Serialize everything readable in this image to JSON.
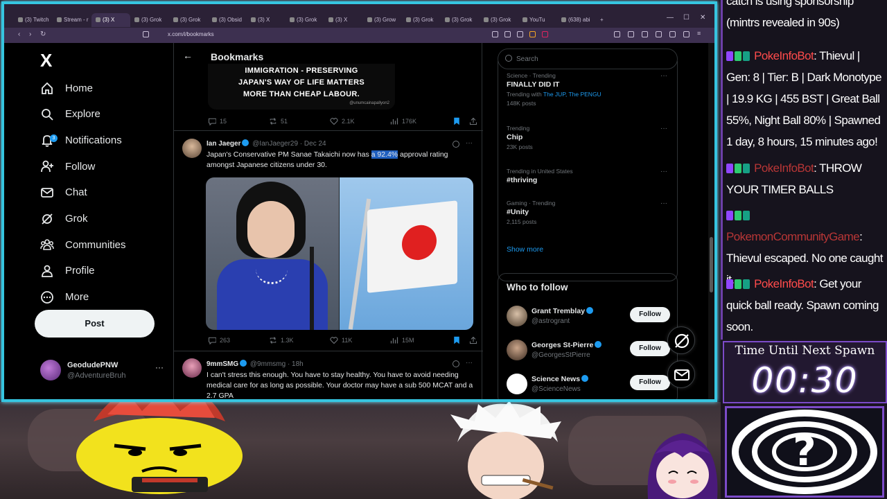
{
  "browser": {
    "tabs": [
      "(3) Twitch",
      "Stream - r",
      "(3) X",
      "(3) Grok",
      "(3) Grok",
      "(3) Obsid",
      "(3) X",
      "(3) Grok",
      "(3) X",
      "(3) Grow",
      "(3) Grok",
      "(3) Grok",
      "(3) Grok",
      "YouTu",
      "(638) abi"
    ],
    "active_tab_index": 2,
    "url": "x.com/i/bookmarks"
  },
  "sidebar": {
    "logo": "X",
    "items": [
      {
        "label": "Home",
        "icon": "home-icon"
      },
      {
        "label": "Explore",
        "icon": "search-icon"
      },
      {
        "label": "Notifications",
        "icon": "bell-icon",
        "badge": "3"
      },
      {
        "label": "Follow",
        "icon": "person-add-icon"
      },
      {
        "label": "Chat",
        "icon": "mail-icon"
      },
      {
        "label": "Grok",
        "icon": "grok-icon"
      },
      {
        "label": "Communities",
        "icon": "communities-icon"
      },
      {
        "label": "Profile",
        "icon": "person-icon"
      },
      {
        "label": "More",
        "icon": "more-circle-icon"
      }
    ],
    "post_label": "Post",
    "account": {
      "name": "GeodudePNW",
      "handle": "@AdventureBruh",
      "more": "···"
    }
  },
  "main": {
    "title": "Bookmarks",
    "prev_tweet": {
      "image_caption_1": "IMMIGRATION - PRESERVING",
      "image_caption_2": "JAPAN'S WAY OF LIFE MATTERS",
      "image_caption_3": "MORE THAN CHEAP LABOUR.",
      "watermark": "@unumcainapallyon2",
      "replies": "15",
      "reposts": "51",
      "likes": "2.1K",
      "views": "176K"
    },
    "tweets": [
      {
        "name": "Ian Jaeger",
        "handle": "@IanJaeger29",
        "date": "· Dec 24",
        "text_before": "Japan's Conservative PM Sanae Takaichi now has ",
        "highlight": "a 92.4%",
        "text_after": " approval rating amongst Japanese citizens under 30.",
        "replies": "263",
        "reposts": "1.3K",
        "likes": "11K",
        "views": "15M"
      },
      {
        "name": "9mmSMG",
        "handle": "@9mmsmg",
        "date": "· 18h",
        "text": "I can't stress this enough. You have to stay healthy. You have to avoid needing medical care for as long as possible. Your doctor may have a sub 500 MCAT and a 2.7 GPA"
      }
    ]
  },
  "right": {
    "search_placeholder": "Search",
    "trends": [
      {
        "category": "Science · Trending",
        "title": "FINALLY DID IT",
        "meta_prefix": "Trending with ",
        "meta_link": "The JUP, The PENGU",
        "meta2": "148K posts"
      },
      {
        "category": "Trending",
        "title": "Chip",
        "meta": "23K posts"
      },
      {
        "category": "Trending in United States",
        "title": "#thriving",
        "meta": ""
      },
      {
        "category": "Gaming · Trending",
        "title": "#Unity",
        "meta": "2,115 posts"
      }
    ],
    "show_more": "Show more",
    "who_to_follow_title": "Who to follow",
    "follow_label": "Follow",
    "who_to_follow": [
      {
        "name": "Grant Tremblay",
        "handle": "@astrogrant"
      },
      {
        "name": "Georges St-Pierre",
        "handle": "@GeorgesStPierre"
      },
      {
        "name": "Science News",
        "handle": "@ScienceNews"
      }
    ]
  },
  "chat": {
    "lines": [
      {
        "user": "",
        "text": "catch is using sponsorship (mintrs revealed in 90s)"
      },
      {
        "user": "PokeInfoBot",
        "text": ": Thievul | Gen: 8 | Tier: B | Dark Monotype | 19.9 KG | 455 BST | Great Ball 55%, Night Ball 80% | Spawned 1 day, 8 hours, 15 minutes ago!"
      },
      {
        "user": "PokeInfoBot",
        "text": ": THROW YOUR TIMER BALLS"
      },
      {
        "user": "PokemonCommunityGame",
        "text": ": Thievul escaped. No one caught it."
      },
      {
        "user": "PokeInfoBot",
        "text": ": Get your quick ball ready. Spawn coming soon."
      }
    ]
  },
  "timer": {
    "label": "Time Until Next Spawn",
    "value": "00:30"
  },
  "colors": {
    "accent": "#1d9bf0",
    "frame": "#36c5e0",
    "chat_user": "#ff4b4b",
    "overlay_purple": "#7c4bc9"
  }
}
